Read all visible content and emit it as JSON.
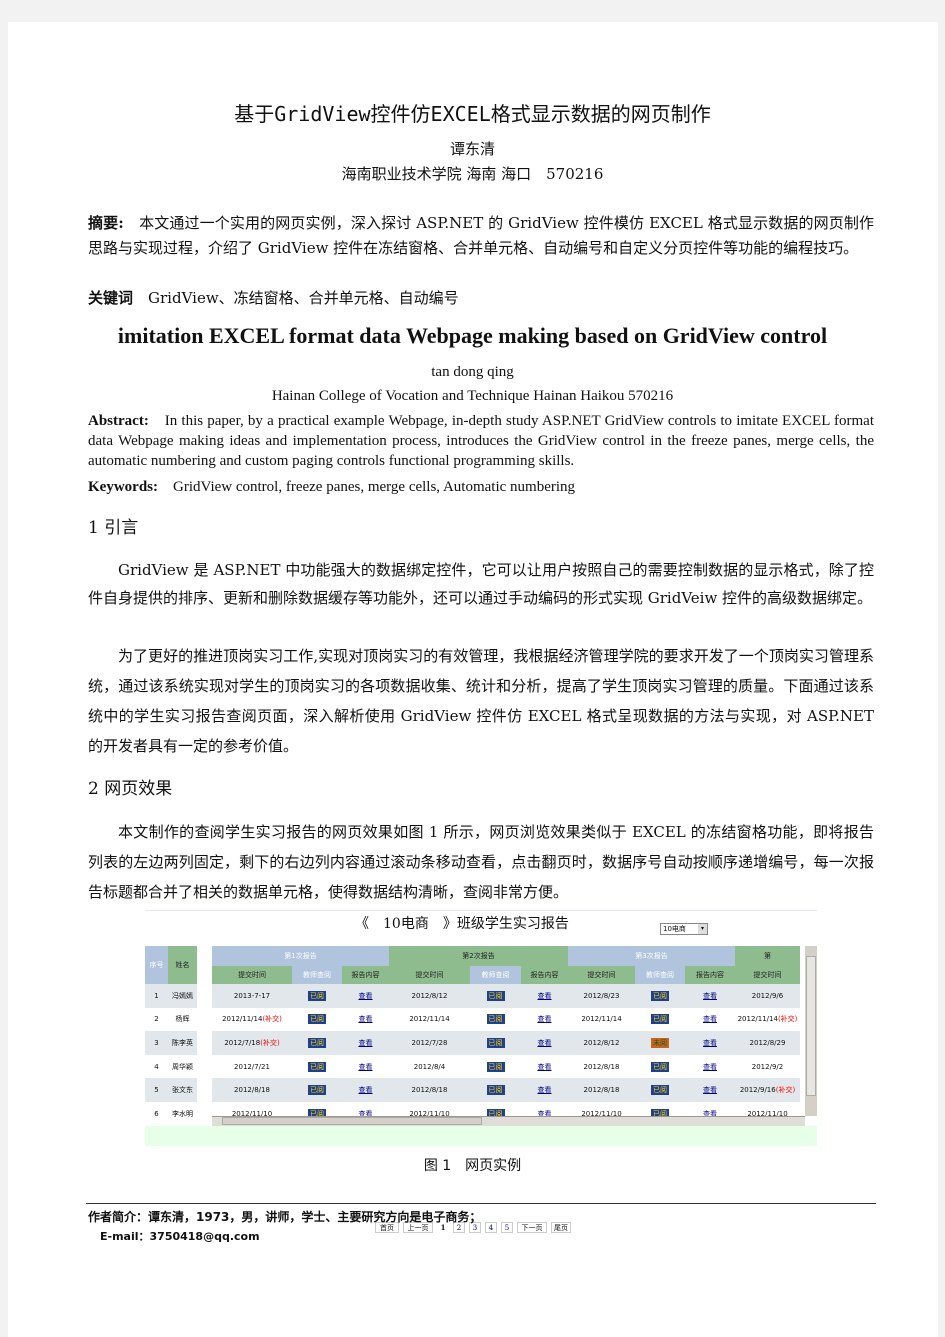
{
  "title": "基于GridView控件仿EXCEL格式显示数据的网页制作",
  "author": "谭东清",
  "affiliation": "海南职业技术学院 海南 海口　570216",
  "abstract_label": "摘要:",
  "abstract": "本文通过一个实用的网页实例，深入探讨 ASP.NET 的 GridView 控件模仿 EXCEL 格式显示数据的网页制作思路与实现过程，介绍了 GridView 控件在冻结窗格、合并单元格、自动编号和自定义分页控件等功能的编程技巧。",
  "keywords_label": "关键词",
  "keywords": "GridView、冻结窗格、合并单元格、自动编号",
  "en_title": "imitation EXCEL format data Webpage making based on GridView control",
  "en_author": "tan dong qing",
  "en_affiliation": "Hainan College of Vocation and Technique Hainan Haikou 570216",
  "en_abstract_label": "Abstract:",
  "en_abstract": "In this paper, by a practical example Webpage, in-depth study ASP.NET GridView controls to imitate EXCEL format data Webpage making ideas and implementation process, introduces the GridView control in the freeze panes, merge cells, the automatic numbering and custom paging controls functional programming skills.",
  "en_keywords_label": "Keywords:",
  "en_keywords": "GridView control, freeze panes, merge cells, Automatic numbering",
  "sec1": "1 引言",
  "sec1_p1": "GridView 是 ASP.NET 中功能强大的数据绑定控件，它可以让用户按照自己的需要控制数据的显示格式，除了控件自身提供的排序、更新和删除数据缓存等功能外，还可以通过手动编码的形式实现 GridVeiw 控件的高级数据绑定。",
  "sec1_p2": "为了更好的推进顶岗实习工作,实现对顶岗实习的有效管理，我根据经济管理学院的要求开发了一个顶岗实习管理系统，通过该系统实现对学生的顶岗实习的各项数据收集、统计和分析，提高了学生顶岗实习管理的质量。下面通过该系统中的学生实习报告查阅页面，深入解析使用 GridView 控件仿 EXCEL 格式呈现数据的方法与实现，对 ASP.NET 的开发者具有一定的参考价值。",
  "sec2": "2 网页效果",
  "sec2_p1": "本文制作的查阅学生实习报告的网页效果如图 1 所示，网页浏览效果类似于 EXCEL 的冻结窗格功能，即将报告列表的左边两列固定，剩下的右边列内容通过滚动条移动查看，点击翻页时，数据序号自动按顺序递增编号，每一次报告标题都合并了相关的数据单元格，使得数据结构清晰，查阅非常方便。",
  "figure": {
    "heading": "《　10电商　》班级学生实习报告",
    "class_select": "10电商",
    "fixed_headers": [
      "序号",
      "姓名"
    ],
    "groups": [
      "第1次报告",
      "第2次报告",
      "第3次报告",
      "第"
    ],
    "sub_headers": [
      "提交时间",
      "教师查阅",
      "报告内容"
    ],
    "late_label": "(补交)",
    "view_label": "查看",
    "rows": [
      {
        "no": "1",
        "name": "冯嫣嫣",
        "r": [
          {
            "t": "2013-7-17",
            "s": "已阅"
          },
          {
            "t": "2012/8/12",
            "s": "已阅"
          },
          {
            "t": "2012/8/23",
            "s": "已阅"
          },
          {
            "t": "2012/9/6"
          }
        ]
      },
      {
        "no": "2",
        "name": "杨辉",
        "r": [
          {
            "t": "2012/11/14",
            "late": true,
            "s": "已阅"
          },
          {
            "t": "2012/11/14",
            "s": "已阅"
          },
          {
            "t": "2012/11/14",
            "s": "已阅"
          },
          {
            "t": "2012/11/14",
            "late": true
          }
        ]
      },
      {
        "no": "3",
        "name": "陈李英",
        "r": [
          {
            "t": "2012/7/18",
            "late": true,
            "s": "已阅"
          },
          {
            "t": "2012/7/28",
            "s": "已阅"
          },
          {
            "t": "2012/8/12",
            "s": "未阅"
          },
          {
            "t": "2012/8/29"
          }
        ]
      },
      {
        "no": "4",
        "name": "周华颖",
        "r": [
          {
            "t": "2012/7/21",
            "s": "已阅"
          },
          {
            "t": "2012/8/4",
            "s": "已阅"
          },
          {
            "t": "2012/8/18",
            "s": "已阅"
          },
          {
            "t": "2012/9/2"
          }
        ]
      },
      {
        "no": "5",
        "name": "张文东",
        "r": [
          {
            "t": "2012/8/18",
            "s": "已阅"
          },
          {
            "t": "2012/8/18",
            "s": "已阅"
          },
          {
            "t": "2012/8/18",
            "s": "已阅"
          },
          {
            "t": "2012/9/16",
            "late": true
          }
        ]
      },
      {
        "no": "6",
        "name": "李水明",
        "r": [
          {
            "t": "2012/11/10",
            "s": "已阅"
          },
          {
            "t": "2012/11/10",
            "s": "已阅"
          },
          {
            "t": "2012/11/10",
            "s": "已阅"
          },
          {
            "t": "2012/11/10"
          }
        ]
      }
    ],
    "pager": [
      "首页",
      "上一页",
      "1",
      "2",
      "3",
      "4",
      "5",
      "下一页",
      "尾页"
    ],
    "current_page": "1",
    "caption": "图 1　网页实例"
  },
  "footnote_bio": "作者简介：谭东清，1973，男，讲师，学士、主要研究方向是电子商务；",
  "footnote_email": "E-mail：3750418@qq.com",
  "colors": {
    "header_blue": "#b0c4de",
    "header_green": "#8fbc8f",
    "row_alt": "#e1e7ea",
    "pager_bg": "#e6ffe6"
  }
}
